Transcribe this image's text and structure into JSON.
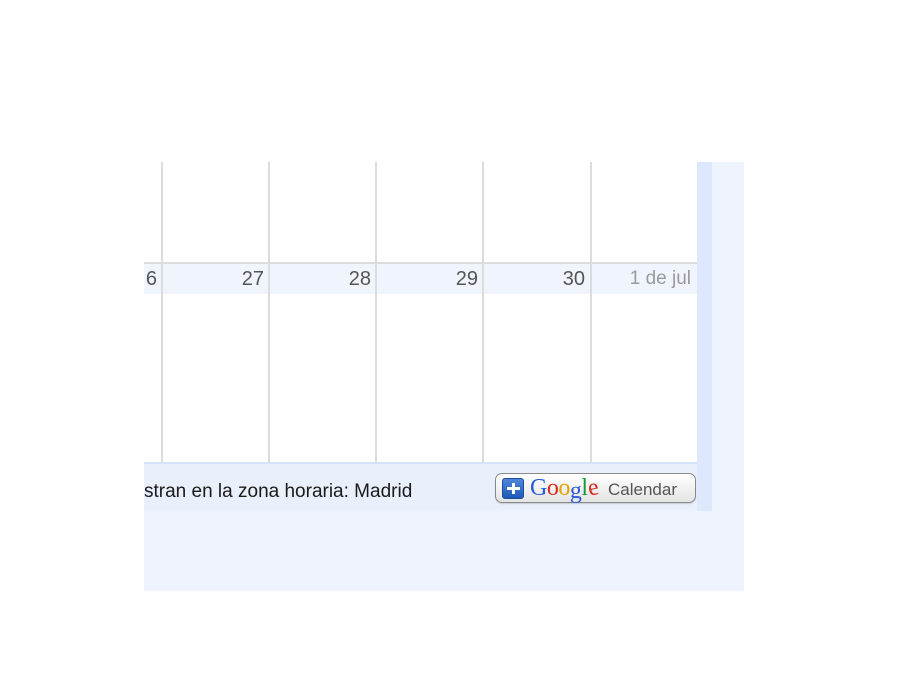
{
  "calendar": {
    "days": [
      {
        "label": "6",
        "muted": false
      },
      {
        "label": "27",
        "muted": false
      },
      {
        "label": "28",
        "muted": false
      },
      {
        "label": "29",
        "muted": false
      },
      {
        "label": "30",
        "muted": false
      },
      {
        "label": "1 de jul",
        "muted": true
      }
    ]
  },
  "footer": {
    "timezone_text": "stran en la zona horaria: Madrid",
    "button": {
      "brand": "Google",
      "brand_letters": [
        {
          "char": "G",
          "color": "#2a5bd7"
        },
        {
          "char": "o",
          "color": "#d62d20"
        },
        {
          "char": "o",
          "color": "#e8a200"
        },
        {
          "char": "g",
          "color": "#2a5bd7"
        },
        {
          "char": "l",
          "color": "#159a37"
        },
        {
          "char": "e",
          "color": "#d62d20"
        }
      ],
      "label": "Calendar",
      "icon": "plus-icon"
    }
  },
  "colors": {
    "frame_bg": "#eef3fd",
    "date_band": "#f0f4fd",
    "grid_line": "#dcdcdc",
    "footer_bg": "#e9effb"
  }
}
